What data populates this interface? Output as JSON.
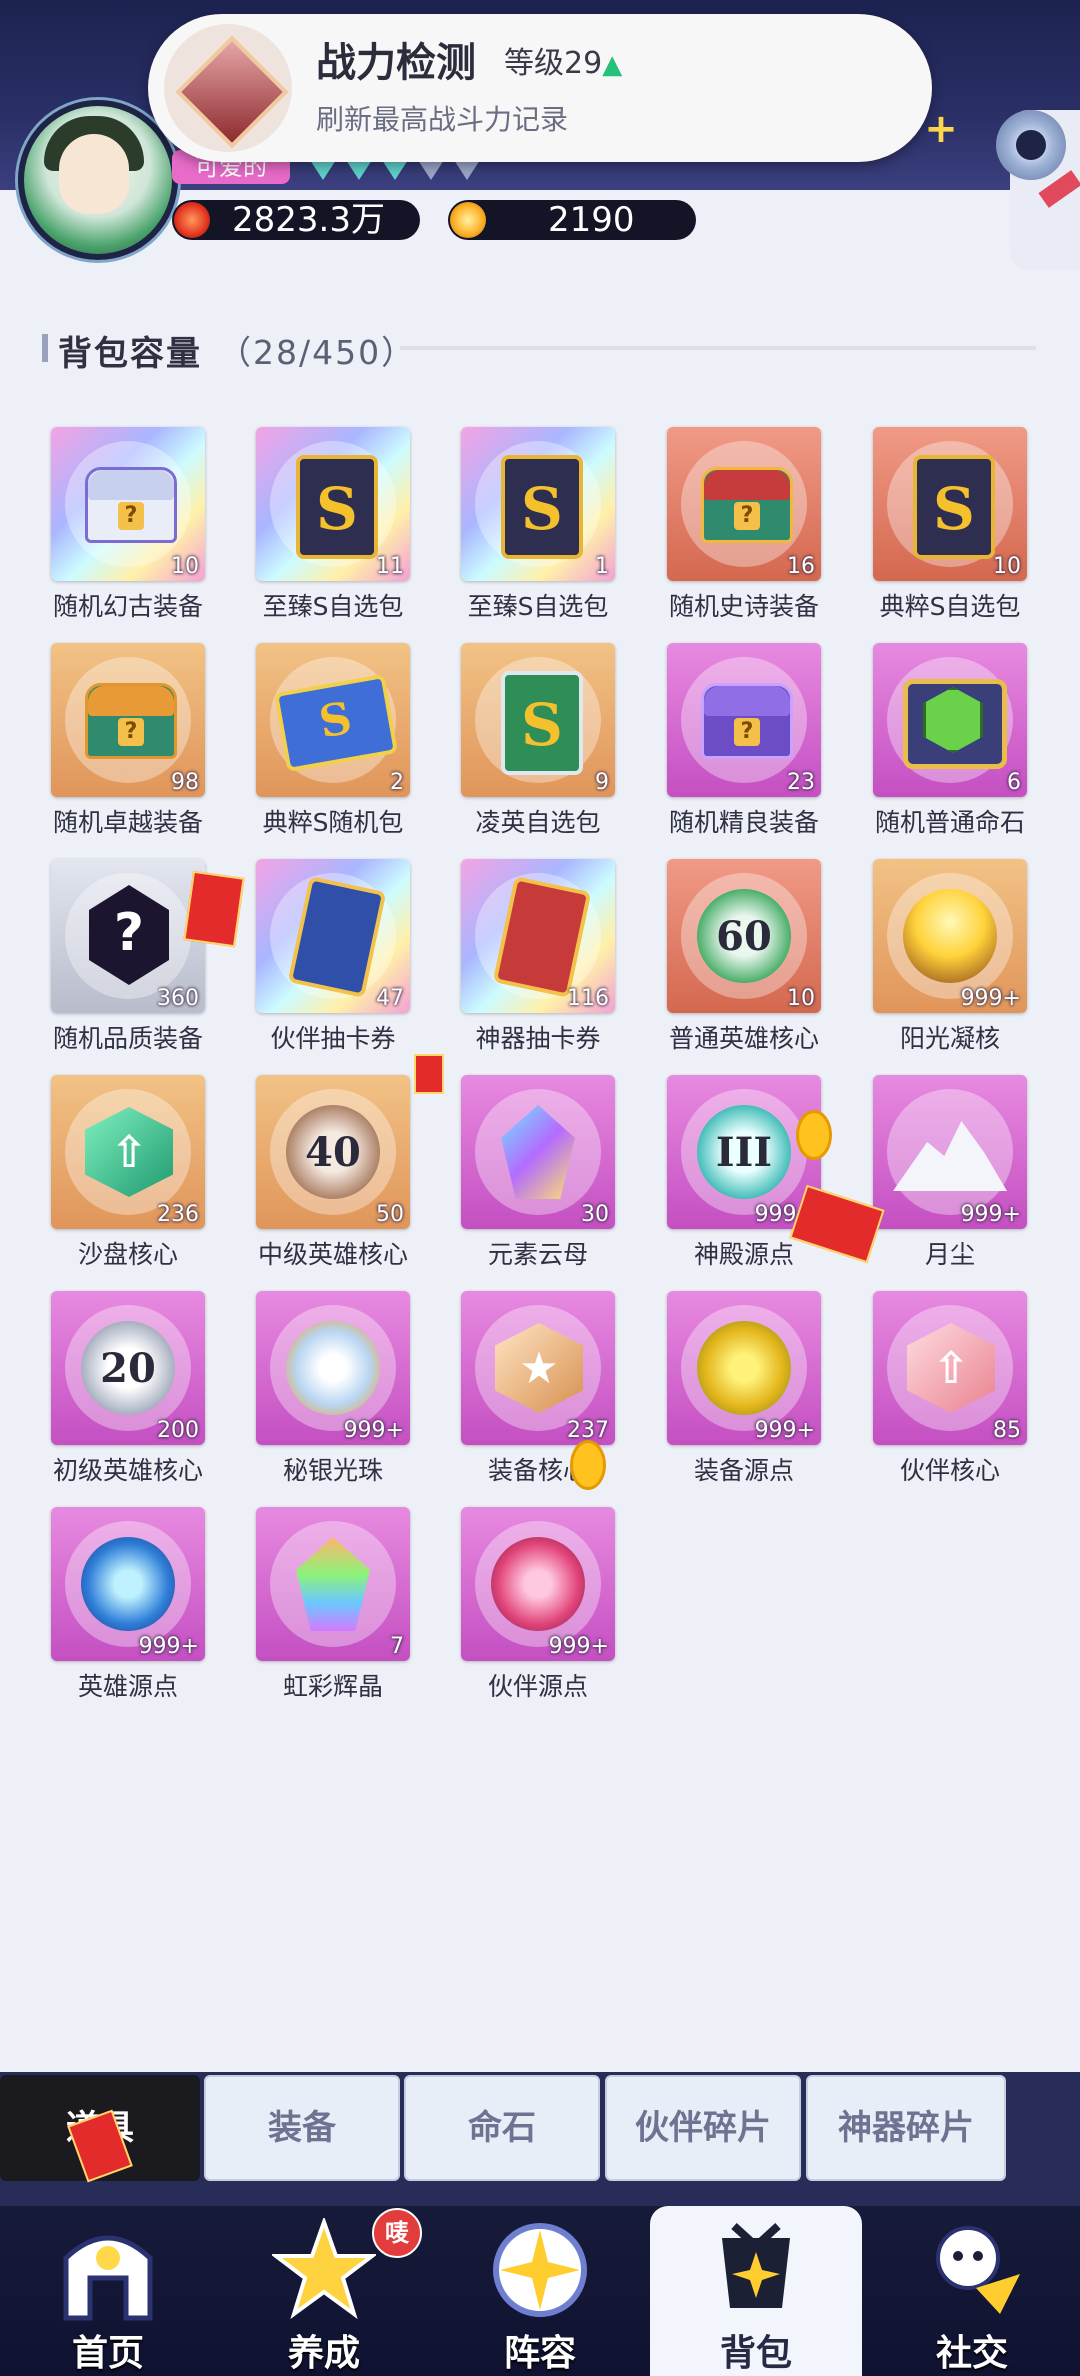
{
  "toast": {
    "title": "战力检测",
    "level": "等级29",
    "subtitle": "刷新最高战斗力记录"
  },
  "profile": {
    "nickname_badge": "可爱的",
    "power": "2823.3万",
    "stars": "2190"
  },
  "backpack": {
    "title": "背包容量",
    "capacity": "（28/450）"
  },
  "items": [
    {
      "name": "随机幻古装备",
      "qty": "10",
      "rarity": "rainbow",
      "icon": "white-chest-icon"
    },
    {
      "name": "至臻S自选包",
      "qty": "11",
      "rarity": "rainbow",
      "icon": "s-card-icon"
    },
    {
      "name": "至臻S自选包",
      "qty": "1",
      "rarity": "rainbow",
      "icon": "s-card-icon"
    },
    {
      "name": "随机史诗装备",
      "qty": "16",
      "rarity": "red",
      "icon": "red-chest-icon"
    },
    {
      "name": "典粹S自选包",
      "qty": "10",
      "rarity": "red",
      "icon": "s-card-icon"
    },
    {
      "name": "随机卓越装备",
      "qty": "98",
      "rarity": "orange",
      "icon": "orange-chest-icon"
    },
    {
      "name": "典粹S随机包",
      "qty": "2",
      "rarity": "orange",
      "icon": "blue-s-ticket-icon"
    },
    {
      "name": "凌英自选包",
      "qty": "9",
      "rarity": "orange",
      "icon": "green-s-card-icon"
    },
    {
      "name": "随机精良装备",
      "qty": "23",
      "rarity": "purple",
      "icon": "purple-chest-icon"
    },
    {
      "name": "随机普通命石",
      "qty": "6",
      "rarity": "purple",
      "icon": "green-gem-frame-icon"
    },
    {
      "name": "随机品质装备",
      "qty": "360",
      "rarity": "gray",
      "icon": "question-mark-icon"
    },
    {
      "name": "伙伴抽卡券",
      "qty": "47",
      "rarity": "rainbow",
      "icon": "partner-card-icon"
    },
    {
      "name": "神器抽卡券",
      "qty": "116",
      "rarity": "rainbow",
      "icon": "artifact-card-icon"
    },
    {
      "name": "普通英雄核心",
      "qty": "10",
      "rarity": "red",
      "icon": "hero-core-60-icon"
    },
    {
      "name": "阳光凝核",
      "qty": "999+",
      "rarity": "orange",
      "icon": "sun-orb-icon"
    },
    {
      "name": "沙盘核心",
      "qty": "236",
      "rarity": "orange",
      "icon": "sandbox-core-icon"
    },
    {
      "name": "中级英雄核心",
      "qty": "50",
      "rarity": "orange",
      "icon": "hero-core-40-icon"
    },
    {
      "name": "元素云母",
      "qty": "30",
      "rarity": "purple",
      "icon": "element-crystal-icon"
    },
    {
      "name": "神殿源点",
      "qty": "999+",
      "rarity": "purple",
      "icon": "temple-orb-icon"
    },
    {
      "name": "月尘",
      "qty": "999+",
      "rarity": "purple",
      "icon": "moon-dust-icon"
    },
    {
      "name": "初级英雄核心",
      "qty": "200",
      "rarity": "purple",
      "icon": "hero-core-20-icon"
    },
    {
      "name": "秘银光珠",
      "qty": "999+",
      "rarity": "purple",
      "icon": "mithril-orb-icon"
    },
    {
      "name": "装备核心",
      "qty": "237",
      "rarity": "purple",
      "icon": "equip-core-icon"
    },
    {
      "name": "装备源点",
      "qty": "999+",
      "rarity": "purple",
      "icon": "equip-orb-icon"
    },
    {
      "name": "伙伴核心",
      "qty": "85",
      "rarity": "purple",
      "icon": "partner-core-icon"
    },
    {
      "name": "英雄源点",
      "qty": "999+",
      "rarity": "purple",
      "icon": "hero-orb-icon"
    },
    {
      "name": "虹彩辉晶",
      "qty": "7",
      "rarity": "purple",
      "icon": "rainbow-crystal-icon"
    },
    {
      "name": "伙伴源点",
      "qty": "999+",
      "rarity": "purple",
      "icon": "partner-orb-icon"
    }
  ],
  "subtabs": [
    "道具",
    "装备",
    "命石",
    "伙伴碎片",
    "神器碎片"
  ],
  "nav": {
    "items": [
      "首页",
      "养成",
      "阵容",
      "背包",
      "社交"
    ],
    "badge": "唛"
  },
  "colors": {
    "header_bg": "#1d2350",
    "power_icon": "#e2341f",
    "active_nav_bg": "#f3f5fc",
    "level_up_arrow": "#25c17a"
  }
}
